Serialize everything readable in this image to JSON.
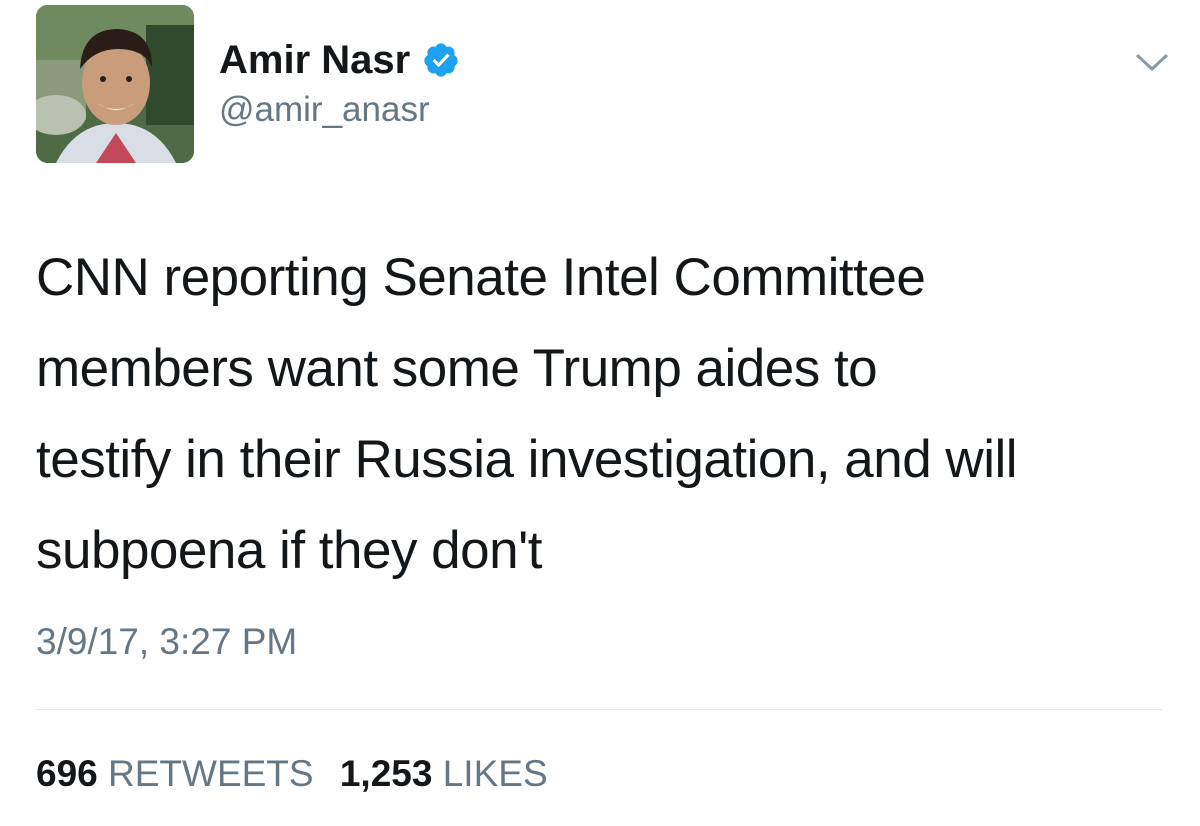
{
  "user": {
    "display_name": "Amir Nasr",
    "handle": "@amir_anasr",
    "verified": true
  },
  "tweet": {
    "text_lines": [
      "CNN reporting Senate Intel Committee",
      "members want some Trump aides to",
      "testify in their Russia investigation, and will",
      "subpoena if they don't"
    ],
    "timestamp": "3/9/17, 3:27 PM"
  },
  "stats": {
    "retweets_count": "696",
    "retweets_label": "RETWEETS",
    "likes_count": "1,253",
    "likes_label": "LIKES"
  },
  "icons": {
    "verified": "verified-badge-icon",
    "menu": "chevron-down-icon"
  },
  "colors": {
    "text_primary": "#14171a",
    "text_secondary": "#657786",
    "verified_blue": "#1da1f2",
    "divider": "#e1e8ed"
  }
}
